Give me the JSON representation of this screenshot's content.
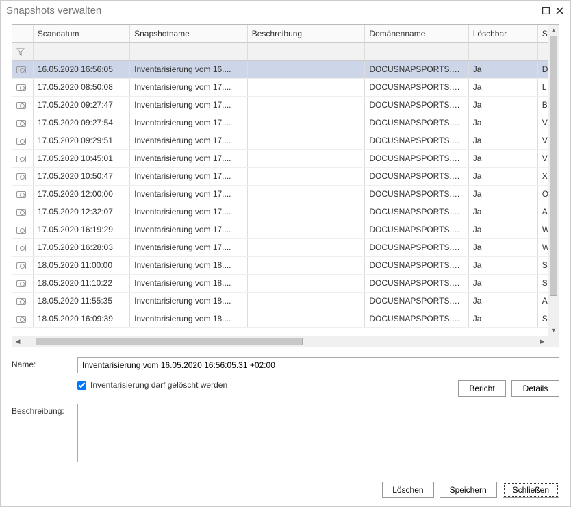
{
  "window": {
    "title": "Snapshots verwalten"
  },
  "grid": {
    "headers": {
      "scandatum": "Scandatum",
      "snapshotname": "Snapshotname",
      "beschreibung": "Beschreibung",
      "domaenenname": "Domänenname",
      "loeschbar": "Löschbar",
      "sn": "Sna"
    },
    "rows": [
      {
        "date": "16.05.2020 16:56:05",
        "name": "Inventarisierung vom 16....",
        "desc": "",
        "domain": "DOCUSNAPSPORTS.C...",
        "del": "Ja",
        "sn": "DN",
        "selected": true
      },
      {
        "date": "17.05.2020 08:50:08",
        "name": "Inventarisierung vom 17....",
        "desc": "",
        "domain": "DOCUSNAPSPORTS.C...",
        "del": "Ja",
        "sn": "LIN"
      },
      {
        "date": "17.05.2020 09:27:47",
        "name": "Inventarisierung vom 17....",
        "desc": "",
        "domain": "DOCUSNAPSPORTS.C...",
        "del": "Ja",
        "sn": "BE"
      },
      {
        "date": "17.05.2020 09:27:54",
        "name": "Inventarisierung vom 17....",
        "desc": "",
        "domain": "DOCUSNAPSPORTS.C...",
        "del": "Ja",
        "sn": "VEI"
      },
      {
        "date": "17.05.2020 09:29:51",
        "name": "Inventarisierung vom 17....",
        "desc": "",
        "domain": "DOCUSNAPSPORTS.C...",
        "del": "Ja",
        "sn": "VEI"
      },
      {
        "date": "17.05.2020 10:45:01",
        "name": "Inventarisierung vom 17....",
        "desc": "",
        "domain": "DOCUSNAPSPORTS.C...",
        "del": "Ja",
        "sn": "VN"
      },
      {
        "date": "17.05.2020 10:50:47",
        "name": "Inventarisierung vom 17....",
        "desc": "",
        "domain": "DOCUSNAPSPORTS.C...",
        "del": "Ja",
        "sn": "Xer"
      },
      {
        "date": "17.05.2020 12:00:00",
        "name": "Inventarisierung vom 17....",
        "desc": "",
        "domain": "DOCUSNAPSPORTS.C...",
        "del": "Ja",
        "sn": "Off"
      },
      {
        "date": "17.05.2020 12:32:07",
        "name": "Inventarisierung vom 17....",
        "desc": "",
        "domain": "DOCUSNAPSPORTS.C...",
        "del": "Ja",
        "sn": "AW"
      },
      {
        "date": "17.05.2020 16:19:29",
        "name": "Inventarisierung vom 17....",
        "desc": "",
        "domain": "DOCUSNAPSPORTS.C...",
        "del": "Ja",
        "sn": "WN"
      },
      {
        "date": "17.05.2020 16:28:03",
        "name": "Inventarisierung vom 17....",
        "desc": "",
        "domain": "DOCUSNAPSPORTS.C...",
        "del": "Ja",
        "sn": "WN"
      },
      {
        "date": "18.05.2020 11:00:00",
        "name": "Inventarisierung vom 18....",
        "desc": "",
        "domain": "DOCUSNAPSPORTS.C...",
        "del": "Ja",
        "sn": "SN"
      },
      {
        "date": "18.05.2020 11:10:22",
        "name": "Inventarisierung vom 18....",
        "desc": "",
        "domain": "DOCUSNAPSPORTS.C...",
        "del": "Ja",
        "sn": "SN"
      },
      {
        "date": "18.05.2020 11:55:35",
        "name": "Inventarisierung vom 18....",
        "desc": "",
        "domain": "DOCUSNAPSPORTS.C...",
        "del": "Ja",
        "sn": "Azu"
      },
      {
        "date": "18.05.2020 16:09:39",
        "name": "Inventarisierung vom 18....",
        "desc": "",
        "domain": "DOCUSNAPSPORTS.C...",
        "del": "Ja",
        "sn": "SN"
      }
    ]
  },
  "form": {
    "name_label": "Name:",
    "name_value": "Inventarisierung vom 16.05.2020 16:56:05.31 +02:00",
    "deletable_label": "Inventarisierung darf gelöscht werden",
    "deletable_checked": true,
    "desc_label": "Beschreibung:",
    "desc_value": ""
  },
  "buttons": {
    "bericht": "Bericht",
    "details": "Details",
    "loeschen": "Löschen",
    "speichern": "Speichern",
    "schliessen": "Schließen"
  }
}
